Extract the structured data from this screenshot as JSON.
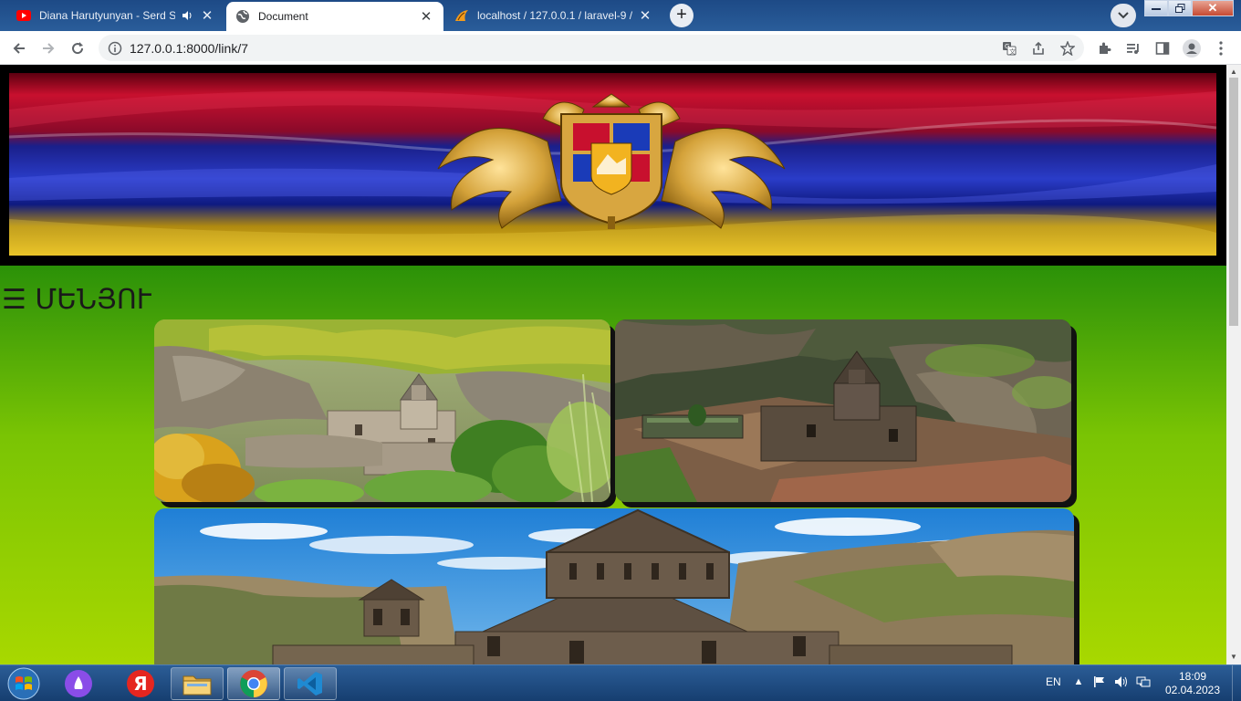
{
  "browser": {
    "tabs": [
      {
        "title": "Diana Harutyunyan - Serd Sa",
        "icon": "youtube-icon",
        "audio": true
      },
      {
        "title": "Document",
        "icon": "globe-icon"
      },
      {
        "title": "localhost / 127.0.0.1 / laravel-9 / ",
        "icon": "phpmyadmin-icon"
      }
    ],
    "url": "127.0.0.1:8000/link/7"
  },
  "page": {
    "menu_label": "☰ ՄԵՆՅՈՒ"
  },
  "taskbar": {
    "language": "EN",
    "time": "18:09",
    "date": "02.04.2023"
  },
  "colors": {
    "tab_strip": "#1d4a86",
    "page_green_top": "#4fa50c",
    "page_green_bottom": "#a8d800",
    "flag_red": "#c8102e",
    "flag_blue": "#1a2fa8",
    "flag_orange": "#e8b400"
  }
}
